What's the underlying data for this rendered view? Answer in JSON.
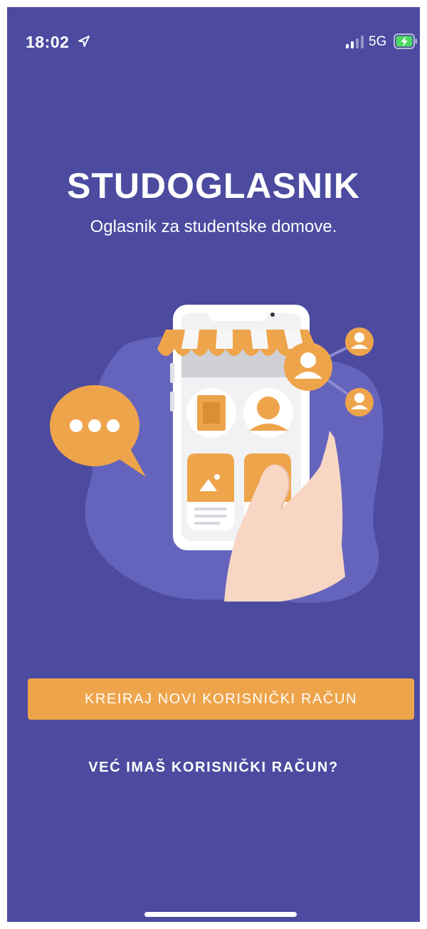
{
  "status_bar": {
    "time": "18:02",
    "network": "5G",
    "icons": [
      "location-arrow-icon",
      "signal-bars-icon",
      "battery-charging-icon"
    ]
  },
  "app": {
    "title": "STUDOGLASNIK",
    "subtitle": "Oglasnik za studentske domove."
  },
  "actions": {
    "create_account": "KREIRAJ NOVI KORISNIČKI RAČUN",
    "have_account": "VEĆ IMAŠ KORISNIČKI RAČUN?"
  },
  "colors": {
    "background": "#4c4ba0",
    "accent": "#eea44a",
    "text": "#ffffff"
  }
}
